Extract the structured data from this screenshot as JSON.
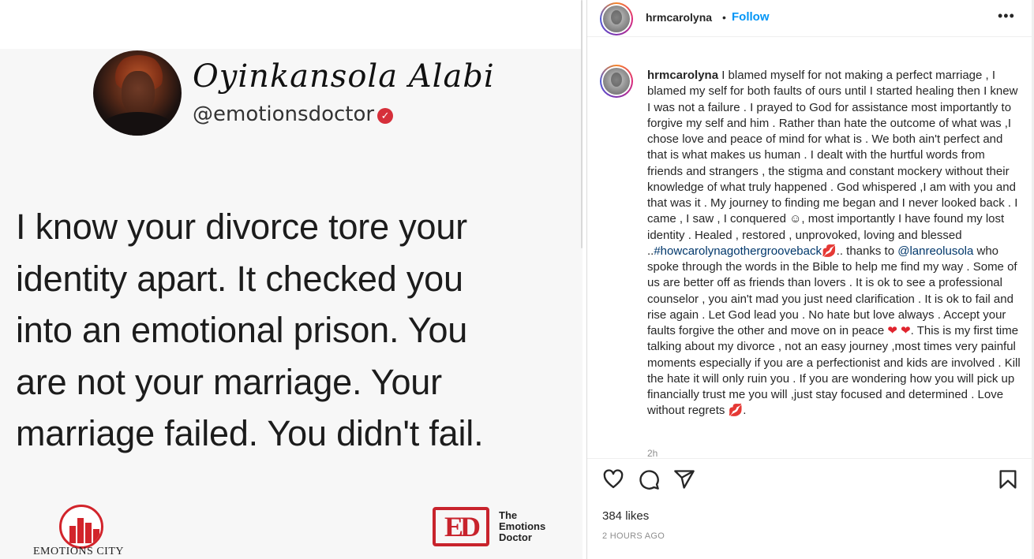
{
  "post_image": {
    "signature": "Oyinkansola Alabi",
    "handle": "@emotionsdoctor",
    "verified_icon": "check-badge-icon",
    "quote_lines": [
      "I know your divorce tore your",
      "identity apart. It checked you",
      "into an emotional prison. You",
      "are not your marriage. Your",
      "marriage failed. You didn't fail."
    ],
    "brand_left": "EMOTIONS CITY",
    "brand_right_mark": "ED",
    "brand_right_words": [
      "The",
      "Emotions",
      "Doctor"
    ],
    "accent_red": "#c8232c"
  },
  "header": {
    "username": "hrmcarolyna",
    "separator": "•",
    "follow_label": "Follow",
    "more_icon": "more-horizontal-icon",
    "follow_color": "#0095f6"
  },
  "caption": {
    "username": "hrmcarolyna",
    "part1": " I blamed myself for not making a perfect marriage , I blamed my self for both faults of ours until I started healing then I knew I was not a failure . I prayed to God for assistance most importantly to forgive my self and him . Rather than hate the outcome of what was ,I chose love and peace of mind for what is . We both ain't perfect and that is what makes us human . I dealt with the hurtful words from friends and strangers , the stigma and constant mockery without their knowledge of what truly happened . God whispered ,I am with you and that was it . My journey to finding me began and I never looked back . I came , I saw , I conquered ",
    "smile_emoji": "☺",
    "part2": ", most importantly I have found my lost identity . Healed , restored , unprovoked, loving and blessed ..",
    "hashtag": "#howcarolynagothergrooveback",
    "lips_emoji": "💋",
    "part3": ".. thanks to ",
    "mention": "@lanreolusola",
    "part4": " who spoke through the words in the Bible to help me find my way . Some of us are better off as friends than lovers . It is ok to see a professional counselor , you ain't mad you just need clarification . It is ok to fail and rise again . Let God lead you . No hate but love always . Accept your faults forgive the other and move on in peace ",
    "hearts_emoji": "❤ ❤",
    "part5": ". This is my first time talking about my divorce , not an easy journey ,most times very painful moments especially if you are a perfectionist and kids are involved . Kill the hate it will only ruin you . If you are wondering how you will pick up financially trust me you will ,just stay focused and determined . Love without regrets ",
    "end_lips_emoji": "💋",
    "part6": ".",
    "time_short": "2h"
  },
  "actions": {
    "like_icon": "heart-icon",
    "comment_icon": "comment-icon",
    "share_icon": "share-icon",
    "save_icon": "bookmark-icon"
  },
  "likes_text": "384 likes",
  "time_ago": "2 HOURS AGO"
}
